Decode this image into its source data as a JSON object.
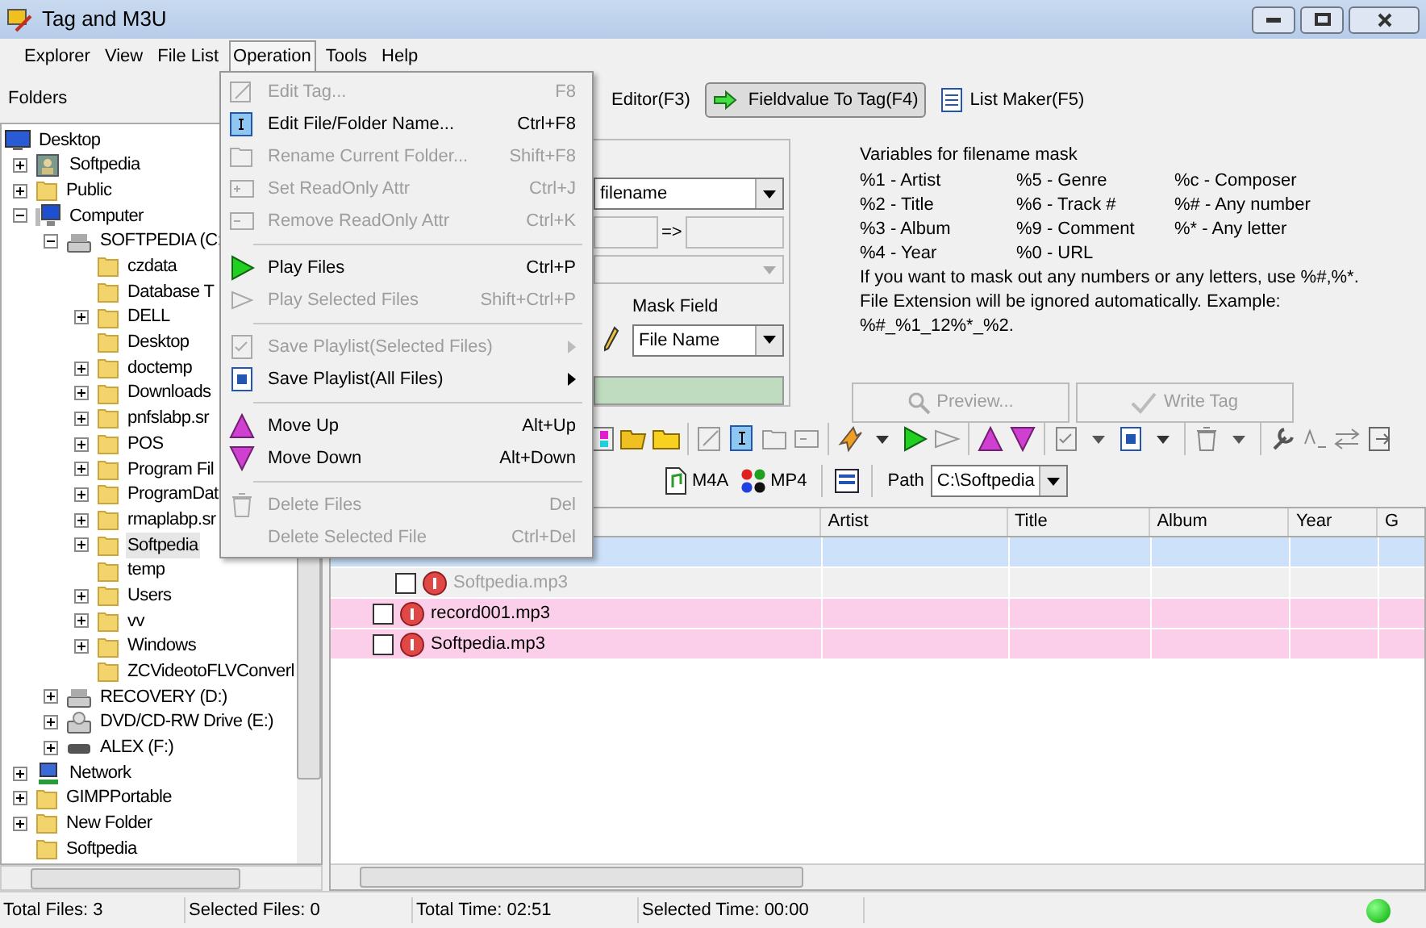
{
  "window": {
    "title": "Tag and M3U"
  },
  "menubar": [
    {
      "label": "Explorer",
      "selected": false
    },
    {
      "label": "View",
      "selected": false
    },
    {
      "label": "File List",
      "selected": false
    },
    {
      "label": "Operation",
      "selected": true
    },
    {
      "label": "Tools",
      "selected": false
    },
    {
      "label": "Help",
      "selected": false
    }
  ],
  "operation_menu": [
    {
      "kind": "item",
      "label": "Edit Tag...",
      "shortcut": "F8",
      "disabled": true
    },
    {
      "kind": "item",
      "label": "Edit File/Folder Name...",
      "shortcut": "Ctrl+F8",
      "disabled": false
    },
    {
      "kind": "item",
      "label": "Rename Current Folder...",
      "shortcut": "Shift+F8",
      "disabled": true
    },
    {
      "kind": "item",
      "label": "Set ReadOnly Attr",
      "shortcut": "Ctrl+J",
      "disabled": true
    },
    {
      "kind": "item",
      "label": "Remove ReadOnly Attr",
      "shortcut": "Ctrl+K",
      "disabled": true
    },
    {
      "kind": "separator"
    },
    {
      "kind": "item",
      "label": "Play Files",
      "shortcut": "Ctrl+P",
      "disabled": false
    },
    {
      "kind": "item",
      "label": "Play Selected Files",
      "shortcut": "Shift+Ctrl+P",
      "disabled": true
    },
    {
      "kind": "separator"
    },
    {
      "kind": "submenu",
      "label": "Save Playlist(Selected Files)",
      "disabled": true
    },
    {
      "kind": "submenu",
      "label": "Save Playlist(All Files)",
      "disabled": false
    },
    {
      "kind": "separator"
    },
    {
      "kind": "item",
      "label": "Move Up",
      "shortcut": "Alt+Up",
      "disabled": false
    },
    {
      "kind": "item",
      "label": "Move Down",
      "shortcut": "Alt+Down",
      "disabled": false
    },
    {
      "kind": "separator"
    },
    {
      "kind": "item",
      "label": "Delete Files",
      "shortcut": "Del",
      "disabled": true
    },
    {
      "kind": "item",
      "label": "Delete Selected File",
      "shortcut": "Ctrl+Del",
      "disabled": true
    }
  ],
  "folders": {
    "title": "Folders",
    "tree": [
      {
        "label": "Desktop",
        "kind": "desktop",
        "children": [
          {
            "label": "Softpedia",
            "kind": "user",
            "expanded": false
          },
          {
            "label": "Public",
            "kind": "folder",
            "expanded": false
          },
          {
            "label": "Computer",
            "kind": "computer",
            "expanded": true,
            "children": [
              {
                "label": "SOFTPEDIA (C:",
                "kind": "drive",
                "expanded": true,
                "children": [
                  {
                    "label": "czdata",
                    "kind": "folder"
                  },
                  {
                    "label": "Database T",
                    "kind": "folder"
                  },
                  {
                    "label": "DELL",
                    "kind": "folder",
                    "expanded": false
                  },
                  {
                    "label": "Desktop",
                    "kind": "folder"
                  },
                  {
                    "label": "doctemp",
                    "kind": "folder",
                    "expanded": false
                  },
                  {
                    "label": "Downloads",
                    "kind": "folder",
                    "expanded": false
                  },
                  {
                    "label": "pnfslabp.sr",
                    "kind": "folder",
                    "expanded": false
                  },
                  {
                    "label": "POS",
                    "kind": "folder",
                    "expanded": false
                  },
                  {
                    "label": "Program Fil",
                    "kind": "folder",
                    "expanded": false
                  },
                  {
                    "label": "ProgramDat",
                    "kind": "folder",
                    "expanded": false
                  },
                  {
                    "label": "rmaplabp.sr",
                    "kind": "folder",
                    "expanded": false
                  },
                  {
                    "label": "Softpedia",
                    "kind": "folder",
                    "expanded": false,
                    "selected": true
                  },
                  {
                    "label": "temp",
                    "kind": "folder"
                  },
                  {
                    "label": "Users",
                    "kind": "folder",
                    "expanded": false
                  },
                  {
                    "label": "vv",
                    "kind": "folder",
                    "expanded": false
                  },
                  {
                    "label": "Windows",
                    "kind": "folder",
                    "expanded": false
                  },
                  {
                    "label": "ZCVideotoFLVConverl",
                    "kind": "folder"
                  }
                ]
              },
              {
                "label": "RECOVERY (D:)",
                "kind": "drive",
                "expanded": false
              },
              {
                "label": "DVD/CD-RW Drive (E:)",
                "kind": "dvd",
                "expanded": false
              },
              {
                "label": "ALEX (F:)",
                "kind": "removable",
                "expanded": false
              }
            ]
          },
          {
            "label": "Network",
            "kind": "network",
            "expanded": false
          },
          {
            "label": "GIMPPortable",
            "kind": "folder",
            "expanded": false
          },
          {
            "label": "New Folder",
            "kind": "folder",
            "expanded": false
          },
          {
            "label": "Softpedia",
            "kind": "folder"
          }
        ]
      }
    ]
  },
  "mode_tabs": [
    {
      "label": "Editor(F3)",
      "selected": false
    },
    {
      "label": "Fieldvalue To Tag(F4)",
      "selected": true
    },
    {
      "label": "List Maker(F5)",
      "selected": false
    }
  ],
  "form": {
    "source": "filename",
    "arrow": "=>",
    "mask_field_label": "Mask Field",
    "mask_field": "File Name"
  },
  "variables": {
    "title": "Variables for filename mask",
    "items": [
      "%1 - Artist",
      "%5 - Genre",
      "%c - Composer",
      "%2 - Title",
      "%6 - Track #",
      "%# - Any number",
      "%3 - Album",
      "%9 - Comment",
      "%* - Any letter",
      "%4 - Year",
      "%0 - URL"
    ],
    "note": "If you want to mask out any numbers or any letters, use %#,%*. File Extension will be ignored automatically. Example: %#_%1_12%*_%2."
  },
  "buttons": [
    {
      "label": "Preview...",
      "disabled": true
    },
    {
      "label": "Write Tag",
      "disabled": true
    }
  ],
  "filters": [
    "M4A",
    "MP4"
  ],
  "path": {
    "label": "Path",
    "value": "C:\\Softpedia"
  },
  "file_list": {
    "columns": [
      "Artist",
      "Title",
      "Album",
      "Year",
      "G"
    ],
    "rows": [
      {
        "kind": "folder",
        "selected": true,
        "children": [
          {
            "kind": "file",
            "name": "Softpedia.mp3",
            "checked": false,
            "disabled": true
          }
        ]
      },
      {
        "kind": "file",
        "name": "record001.mp3",
        "checked": false,
        "disabled": false
      },
      {
        "kind": "file",
        "name": "Softpedia.mp3",
        "checked": false,
        "disabled": false
      }
    ]
  },
  "status_bar": [
    "Total Files: 3",
    "Selected Files: 0",
    "Total Time: 02:51",
    "Selected Time: 00:00"
  ]
}
